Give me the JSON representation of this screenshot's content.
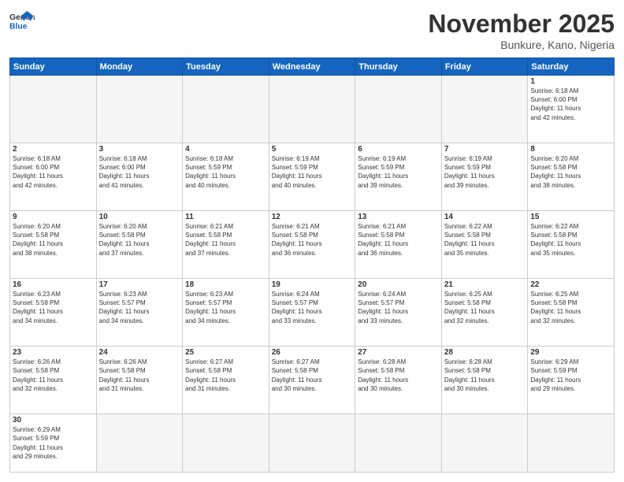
{
  "header": {
    "logo_general": "General",
    "logo_blue": "Blue",
    "month_title": "November 2025",
    "location": "Bunkure, Kano, Nigeria"
  },
  "weekdays": [
    "Sunday",
    "Monday",
    "Tuesday",
    "Wednesday",
    "Thursday",
    "Friday",
    "Saturday"
  ],
  "weeks": [
    [
      {
        "day": "",
        "info": ""
      },
      {
        "day": "",
        "info": ""
      },
      {
        "day": "",
        "info": ""
      },
      {
        "day": "",
        "info": ""
      },
      {
        "day": "",
        "info": ""
      },
      {
        "day": "",
        "info": ""
      },
      {
        "day": "1",
        "info": "Sunrise: 6:18 AM\nSunset: 6:00 PM\nDaylight: 11 hours\nand 42 minutes."
      }
    ],
    [
      {
        "day": "2",
        "info": "Sunrise: 6:18 AM\nSunset: 6:00 PM\nDaylight: 11 hours\nand 42 minutes."
      },
      {
        "day": "3",
        "info": "Sunrise: 6:18 AM\nSunset: 6:00 PM\nDaylight: 11 hours\nand 41 minutes."
      },
      {
        "day": "4",
        "info": "Sunrise: 6:18 AM\nSunset: 5:59 PM\nDaylight: 11 hours\nand 40 minutes."
      },
      {
        "day": "5",
        "info": "Sunrise: 6:19 AM\nSunset: 5:59 PM\nDaylight: 11 hours\nand 40 minutes."
      },
      {
        "day": "6",
        "info": "Sunrise: 6:19 AM\nSunset: 5:59 PM\nDaylight: 11 hours\nand 39 minutes."
      },
      {
        "day": "7",
        "info": "Sunrise: 6:19 AM\nSunset: 5:59 PM\nDaylight: 11 hours\nand 39 minutes."
      },
      {
        "day": "8",
        "info": "Sunrise: 6:20 AM\nSunset: 5:58 PM\nDaylight: 11 hours\nand 38 minutes."
      }
    ],
    [
      {
        "day": "9",
        "info": "Sunrise: 6:20 AM\nSunset: 5:58 PM\nDaylight: 11 hours\nand 38 minutes."
      },
      {
        "day": "10",
        "info": "Sunrise: 6:20 AM\nSunset: 5:58 PM\nDaylight: 11 hours\nand 37 minutes."
      },
      {
        "day": "11",
        "info": "Sunrise: 6:21 AM\nSunset: 5:58 PM\nDaylight: 11 hours\nand 37 minutes."
      },
      {
        "day": "12",
        "info": "Sunrise: 6:21 AM\nSunset: 5:58 PM\nDaylight: 11 hours\nand 36 minutes."
      },
      {
        "day": "13",
        "info": "Sunrise: 6:21 AM\nSunset: 5:58 PM\nDaylight: 11 hours\nand 36 minutes."
      },
      {
        "day": "14",
        "info": "Sunrise: 6:22 AM\nSunset: 5:58 PM\nDaylight: 11 hours\nand 35 minutes."
      },
      {
        "day": "15",
        "info": "Sunrise: 6:22 AM\nSunset: 5:58 PM\nDaylight: 11 hours\nand 35 minutes."
      }
    ],
    [
      {
        "day": "16",
        "info": "Sunrise: 6:23 AM\nSunset: 5:58 PM\nDaylight: 11 hours\nand 34 minutes."
      },
      {
        "day": "17",
        "info": "Sunrise: 6:23 AM\nSunset: 5:57 PM\nDaylight: 11 hours\nand 34 minutes."
      },
      {
        "day": "18",
        "info": "Sunrise: 6:23 AM\nSunset: 5:57 PM\nDaylight: 11 hours\nand 34 minutes."
      },
      {
        "day": "19",
        "info": "Sunrise: 6:24 AM\nSunset: 5:57 PM\nDaylight: 11 hours\nand 33 minutes."
      },
      {
        "day": "20",
        "info": "Sunrise: 6:24 AM\nSunset: 5:57 PM\nDaylight: 11 hours\nand 33 minutes."
      },
      {
        "day": "21",
        "info": "Sunrise: 6:25 AM\nSunset: 5:58 PM\nDaylight: 11 hours\nand 32 minutes."
      },
      {
        "day": "22",
        "info": "Sunrise: 6:25 AM\nSunset: 5:58 PM\nDaylight: 11 hours\nand 32 minutes."
      }
    ],
    [
      {
        "day": "23",
        "info": "Sunrise: 6:26 AM\nSunset: 5:58 PM\nDaylight: 11 hours\nand 32 minutes."
      },
      {
        "day": "24",
        "info": "Sunrise: 6:26 AM\nSunset: 5:58 PM\nDaylight: 11 hours\nand 31 minutes."
      },
      {
        "day": "25",
        "info": "Sunrise: 6:27 AM\nSunset: 5:58 PM\nDaylight: 11 hours\nand 31 minutes."
      },
      {
        "day": "26",
        "info": "Sunrise: 6:27 AM\nSunset: 5:58 PM\nDaylight: 11 hours\nand 30 minutes."
      },
      {
        "day": "27",
        "info": "Sunrise: 6:28 AM\nSunset: 5:58 PM\nDaylight: 11 hours\nand 30 minutes."
      },
      {
        "day": "28",
        "info": "Sunrise: 6:28 AM\nSunset: 5:58 PM\nDaylight: 11 hours\nand 30 minutes."
      },
      {
        "day": "29",
        "info": "Sunrise: 6:29 AM\nSunset: 5:59 PM\nDaylight: 11 hours\nand 29 minutes."
      }
    ],
    [
      {
        "day": "30",
        "info": "Sunrise: 6:29 AM\nSunset: 5:59 PM\nDaylight: 11 hours\nand 29 minutes."
      },
      {
        "day": "",
        "info": ""
      },
      {
        "day": "",
        "info": ""
      },
      {
        "day": "",
        "info": ""
      },
      {
        "day": "",
        "info": ""
      },
      {
        "day": "",
        "info": ""
      },
      {
        "day": "",
        "info": ""
      }
    ]
  ]
}
